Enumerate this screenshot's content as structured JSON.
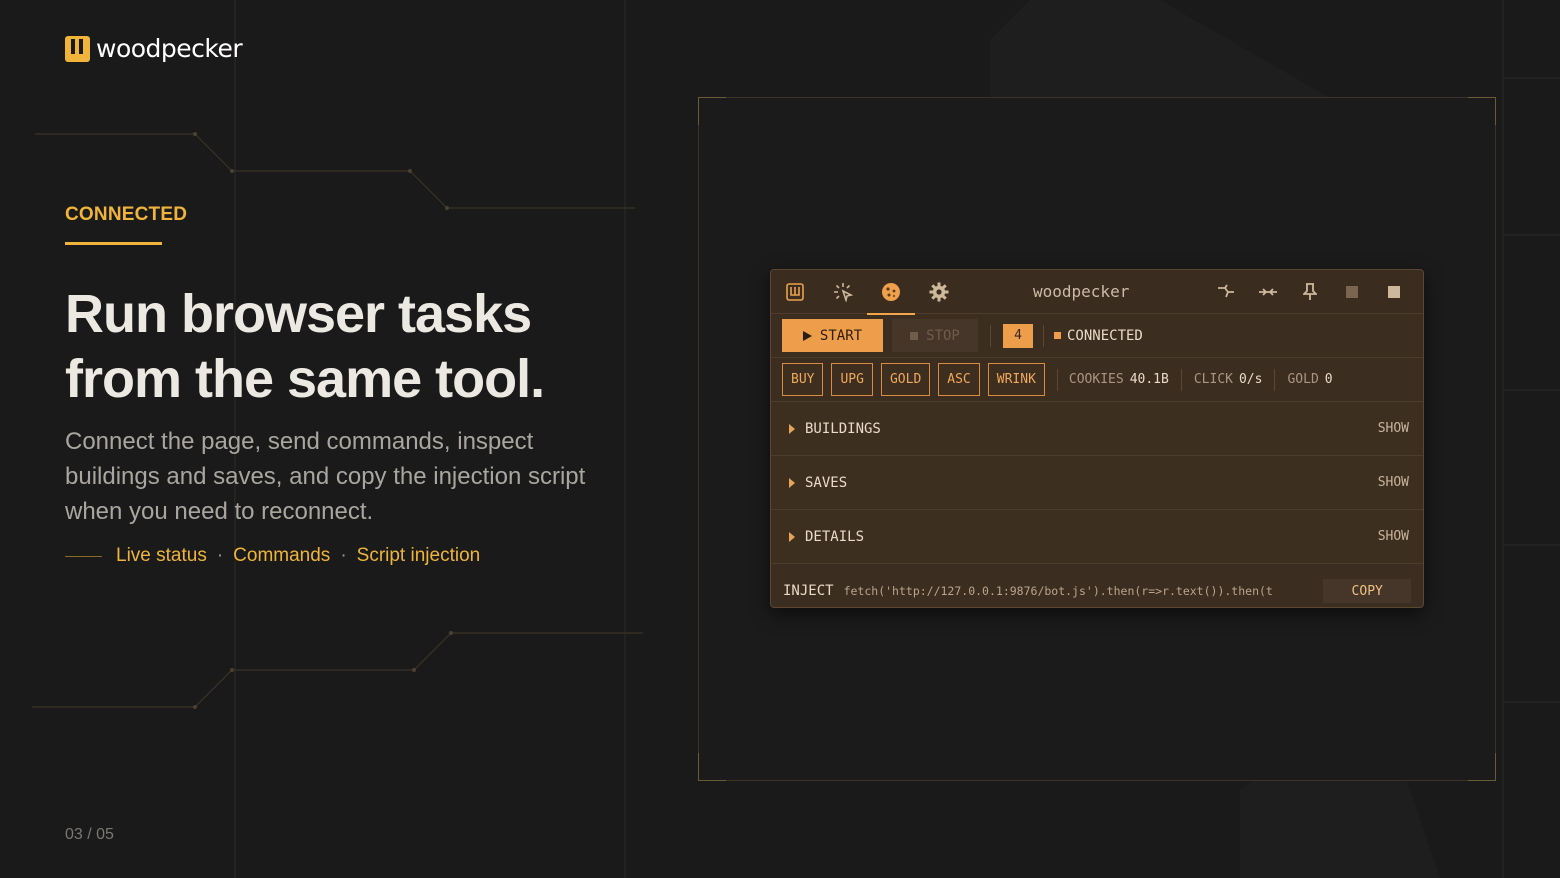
{
  "brand": {
    "name": "woodpecker"
  },
  "hero": {
    "eyebrow": "CONNECTED",
    "headline_line1": "Run browser tasks",
    "headline_line2": "from the same tool.",
    "subcopy": "Connect the page, send commands, inspect buildings and saves, and copy the injection script when you need to reconnect.",
    "tags": [
      "Live status",
      "Commands",
      "Script injection"
    ],
    "tag_separator": "·"
  },
  "pager": {
    "text": "03 / 05"
  },
  "widget": {
    "title": "woodpecker",
    "tabs": [
      {
        "icon": "logo-icon"
      },
      {
        "icon": "click-sparkle-icon"
      },
      {
        "icon": "cookie-icon",
        "active": true
      },
      {
        "icon": "gear-icon"
      }
    ],
    "window_controls": [
      "snap-icon",
      "collapse-icon",
      "pin-icon",
      "minimize-icon",
      "close-icon"
    ],
    "toolbar": {
      "start_label": "START",
      "stop_label": "STOP",
      "count": "4",
      "status": "CONNECTED"
    },
    "commands": [
      "BUY",
      "UPG",
      "GOLD",
      "ASC",
      "WRINK"
    ],
    "stats": [
      {
        "label": "COOKIES",
        "value": "40.1B"
      },
      {
        "label": "CLICK",
        "value": "0/s"
      },
      {
        "label": "GOLD",
        "value": "0"
      }
    ],
    "sections": [
      {
        "label": "BUILDINGS",
        "action": "SHOW"
      },
      {
        "label": "SAVES",
        "action": "SHOW"
      },
      {
        "label": "DETAILS",
        "action": "SHOW"
      }
    ],
    "inject": {
      "label": "INJECT",
      "code": "fetch('http://127.0.0.1:9876/bot.js').then(r=>r.text()).then(t",
      "copy_label": "COPY"
    }
  },
  "colors": {
    "accent": "#f0b43a",
    "widget_accent": "#ee9d4b",
    "background": "#1a1a1a",
    "widget_bg": "#3b2d1f"
  }
}
